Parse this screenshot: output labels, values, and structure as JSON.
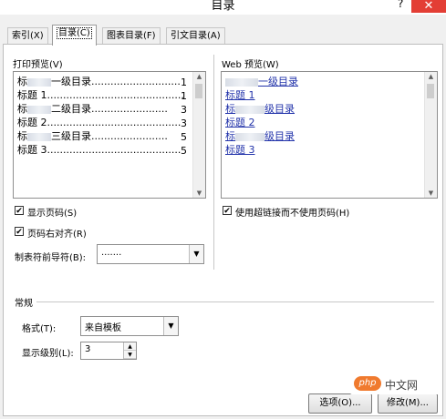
{
  "window": {
    "title": "目录",
    "help": "?",
    "close": "✕"
  },
  "tabs": [
    "索引(X)",
    "目录(C)",
    "图表目录(F)",
    "引文目录(A)"
  ],
  "print_preview": {
    "label": "打印预览(V)",
    "rows": [
      {
        "before": "标",
        "after": "一级目录",
        "dots": "............................",
        "page": "1"
      },
      {
        "before": "标题 1",
        "after": "",
        "dots": "...........................................",
        "page": "1"
      },
      {
        "before": "标",
        "after": "二级目录",
        "dots": "........................",
        "page": "3"
      },
      {
        "before": "标题 2",
        "after": "",
        "dots": "..........................................",
        "page": "3"
      },
      {
        "before": "标",
        "after": "三级目录",
        "dots": "........................",
        "page": "5"
      },
      {
        "before": "标题 3",
        "after": "",
        "dots": "..........................................",
        "page": "5"
      }
    ]
  },
  "web_preview": {
    "label": "Web 预览(W)",
    "rows": [
      {
        "before": "",
        "after": "一级目录"
      },
      {
        "before": "标题 1",
        "after": ""
      },
      {
        "before": "标",
        "after": "级目录"
      },
      {
        "before": "标题 2",
        "after": ""
      },
      {
        "before": "标",
        "after": "级目录"
      },
      {
        "before": "标题 3",
        "after": ""
      }
    ]
  },
  "options": {
    "show_page_numbers": {
      "label": "显示页码(S)",
      "checked": true
    },
    "right_align": {
      "label": "页码右对齐(R)",
      "checked": true
    },
    "use_hyperlinks": {
      "label": "使用超链接而不使用页码(H)",
      "checked": true
    },
    "tab_leader": {
      "label": "制表符前导符(B):",
      "value": "......."
    }
  },
  "general": {
    "label": "常规",
    "format": {
      "label": "格式(T):",
      "value": "来自模板"
    },
    "levels": {
      "label": "显示级别(L):",
      "value": "3"
    }
  },
  "buttons": {
    "options": "选项(O)...",
    "modify": "修改(M)..."
  },
  "watermark": {
    "logo": "php",
    "text": "中文网"
  }
}
